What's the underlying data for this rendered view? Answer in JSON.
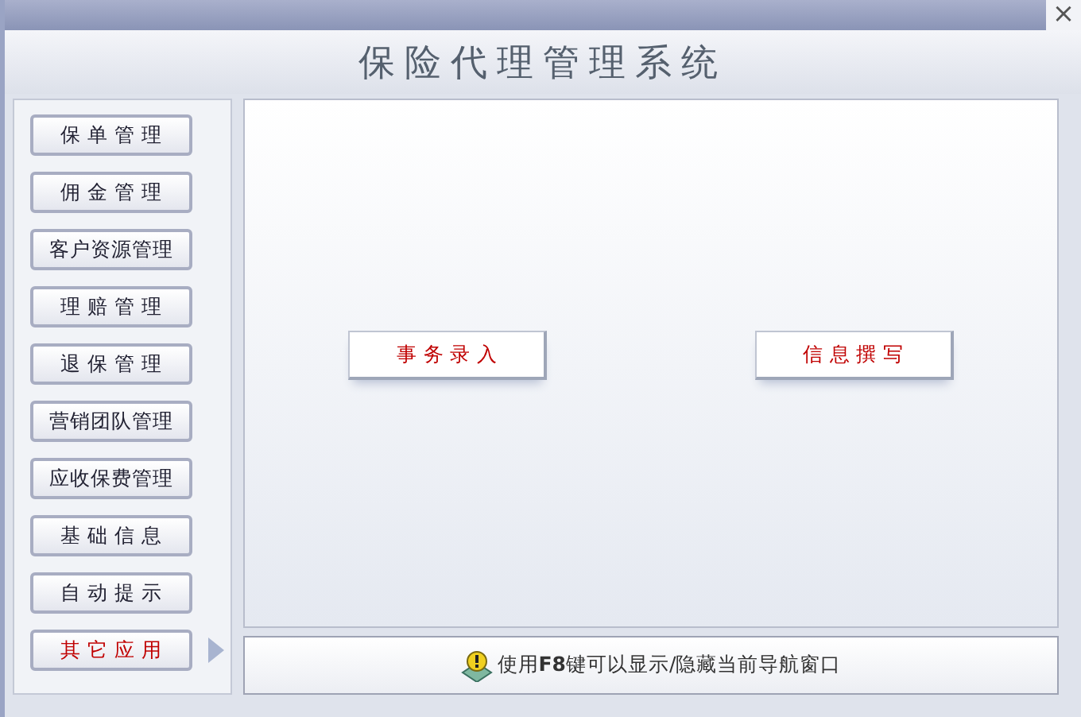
{
  "window": {
    "title": "保险代理管理系统",
    "close": "×"
  },
  "nav": [
    {
      "label": "保 单 管 理",
      "selected": false
    },
    {
      "label": "佣 金 管 理",
      "selected": false
    },
    {
      "label": "客户资源管理",
      "selected": false
    },
    {
      "label": "理 赔 管 理",
      "selected": false
    },
    {
      "label": "退 保 管 理",
      "selected": false
    },
    {
      "label": "营销团队管理",
      "selected": false
    },
    {
      "label": "应收保费管理",
      "selected": false
    },
    {
      "label": "基 础 信 息",
      "selected": false
    },
    {
      "label": "自 动 提 示",
      "selected": false
    },
    {
      "label": "其 它 应 用",
      "selected": true
    }
  ],
  "actions": [
    "事 务 录 入",
    "信 息 撰 写"
  ],
  "hint": "使用**F8**键可以显示/隐藏当前导航窗口"
}
